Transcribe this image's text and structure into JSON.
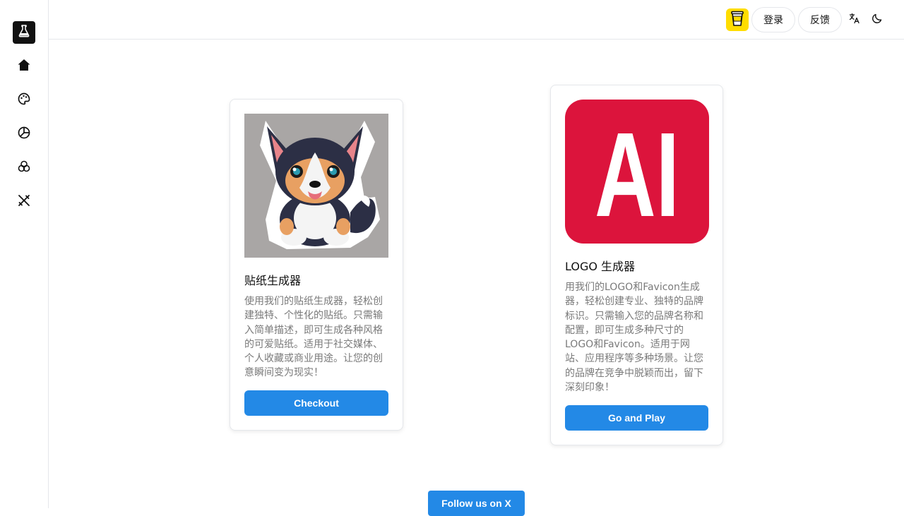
{
  "sidebar": {
    "logo_icon": "flask-icon",
    "items": [
      {
        "icon": "home-icon"
      },
      {
        "icon": "palette-icon"
      },
      {
        "icon": "chart-pie-icon"
      },
      {
        "icon": "circles-icon"
      },
      {
        "icon": "tools-icon"
      }
    ]
  },
  "header": {
    "coffee_icon": "coffee-cup-icon",
    "login_label": "登录",
    "feedback_label": "反馈",
    "language_icon": "language-icon",
    "theme_icon": "moon-icon"
  },
  "cards": [
    {
      "title": "贴纸生成器",
      "description": "使用我们的贴纸生成器，轻松创建独特、个性化的贴纸。只需输入简单描述，即可生成各种风格的可爱贴纸。适用于社交媒体、个人收藏或商业用途。让您的创意瞬间变为现实！",
      "button_label": "Checkout",
      "image": "corgi-sticker"
    },
    {
      "title": "LOGO 生成器",
      "description": "用我们的LOGO和Favicon生成器，轻松创建专业、独特的品牌标识。只需输入您的品牌名称和配置，即可生成多种尺寸的LOGO和Favicon。适用于网站、应用程序等多种场景。让您的品牌在竞争中脱颖而出，留下深刻印象！",
      "button_label": "Go and Play",
      "image_text": "AI"
    }
  ],
  "footer": {
    "follow_label": "Follow us on X"
  },
  "colors": {
    "accent": "#2389e6",
    "logo_bg": "#dc143c",
    "coffee_bg": "#ffdd00"
  }
}
